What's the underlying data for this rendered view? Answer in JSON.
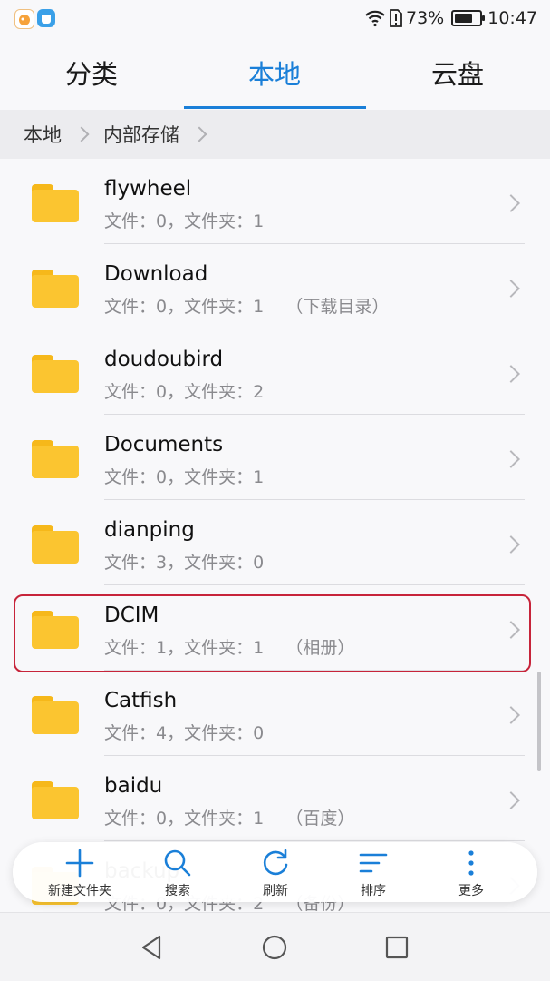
{
  "status_bar": {
    "battery": "73%",
    "time": "10:47"
  },
  "tabs": [
    {
      "label": "分类",
      "active": false
    },
    {
      "label": "本地",
      "active": true
    },
    {
      "label": "云盘",
      "active": false
    }
  ],
  "breadcrumb": [
    "本地",
    "内部存储"
  ],
  "folders": [
    {
      "name": "flywheel",
      "meta": "文件：0，文件夹：1"
    },
    {
      "name": "Download",
      "meta": "文件：0，文件夹：1",
      "note": "（下载目录）"
    },
    {
      "name": "doudoubird",
      "meta": "文件：0，文件夹：2"
    },
    {
      "name": "Documents",
      "meta": "文件：0，文件夹：1"
    },
    {
      "name": "dianping",
      "meta": "文件：3，文件夹：0"
    },
    {
      "name": "DCIM",
      "meta": "文件：1，文件夹：1",
      "note": "（相册）"
    },
    {
      "name": "Catfish",
      "meta": "文件：4，文件夹：0"
    },
    {
      "name": "baidu",
      "meta": "文件：0，文件夹：1",
      "note": "（百度）"
    },
    {
      "name": "backup",
      "meta": "文件：0，文件夹：2",
      "note": "（备份）"
    }
  ],
  "toolbar": [
    {
      "label": "新建文件夹",
      "icon": "plus-icon"
    },
    {
      "label": "搜索",
      "icon": "search-icon"
    },
    {
      "label": "刷新",
      "icon": "refresh-icon"
    },
    {
      "label": "排序",
      "icon": "sort-icon"
    },
    {
      "label": "更多",
      "icon": "more-icon"
    }
  ],
  "colors": {
    "accent": "#1a7fd8",
    "folder": "#fbc530",
    "highlight": "#c7243a"
  }
}
